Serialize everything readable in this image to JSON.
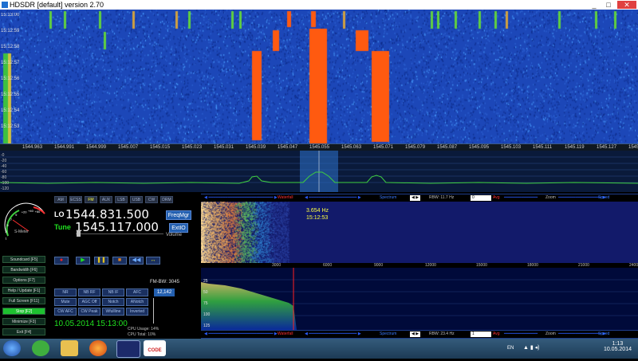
{
  "window": {
    "title": "HDSDR [default] version 2.70",
    "minimize": "_",
    "maximize": "□",
    "close": "✕"
  },
  "waterfall_top": {
    "time_labels": [
      "15:13:00",
      "15:12:59",
      "15:12:58",
      "15:12:57",
      "15:12:56",
      "15:12:55",
      "15:12:54",
      "15:12:53"
    ],
    "colors": {
      "background": "#1c47b8",
      "signal": "#ff5a10",
      "marker_green": "#60d040",
      "marker_yellow": "#d0c040"
    }
  },
  "freq_axis": {
    "labels": [
      "1544.963",
      "1544.991",
      "1544.999",
      "1545.007",
      "1545.015",
      "1545.023",
      "1545.031",
      "1545.039",
      "1545.047",
      "1545.055",
      "1545.063",
      "1545.071",
      "1545.079",
      "1545.087",
      "1545.095",
      "1545.103",
      "1545.111",
      "1545.119",
      "1545.127",
      "1545.135"
    ]
  },
  "spectrum": {
    "db_labels": [
      "-0",
      "-20",
      "-40",
      "-60",
      "-80",
      "-100",
      "-120"
    ]
  },
  "mode_buttons": [
    {
      "label": "AM"
    },
    {
      "label": "ECSS"
    },
    {
      "label": "FM",
      "active": true
    },
    {
      "label": "AUX"
    },
    {
      "label": "LSB"
    },
    {
      "label": "USB"
    },
    {
      "label": "CW"
    },
    {
      "label": "DRM"
    }
  ],
  "lo": {
    "label": "LO",
    "value": "1544.831.500"
  },
  "tune": {
    "label": "Tune",
    "value": "1545.117.000"
  },
  "freqmgr_button": "FreqMgr",
  "extio_button": "ExtIO",
  "volume_label": "Volume",
  "smeter": {
    "scale_labels": [
      "1",
      "3",
      "5",
      "7",
      "9",
      "+20",
      "+40",
      "+60"
    ],
    "label": "S-Meter"
  },
  "left_buttons": [
    {
      "label": "Soundcard [F5]"
    },
    {
      "label": "Bandwidth [F6]"
    },
    {
      "label": "Options [F7]"
    },
    {
      "label": "Help / Update [F1]"
    },
    {
      "label": "Full Screen [F11]"
    },
    {
      "label": "Stop [F2]",
      "green": true
    },
    {
      "label": "Minimize [F3]"
    },
    {
      "label": "Exit [F4]"
    }
  ],
  "transport": {
    "record": "●",
    "play": "▶",
    "pause": "❚❚",
    "stop": "■",
    "rewind": "◀◀",
    "loop": "↔"
  },
  "dsp_buttons": [
    [
      "NR",
      "NB RF",
      "NB IF",
      "AFC"
    ],
    [
      "Mute",
      "AGC Off",
      "Notch",
      "ANotch"
    ],
    [
      "CW AFC",
      "CW Peak",
      "Wfullline",
      "Inverted"
    ]
  ],
  "fm_bw": {
    "label": "FM-BW: 3045",
    "value": "12,142"
  },
  "datetime": "10.05.2014 15:13:00",
  "cpu": {
    "line1": "CPU Usage: 14%",
    "line2": "CPU Total: 10%"
  },
  "lower_waterfall": {
    "freq_readout": "3.654 Hz",
    "time_readout": "15:12:53",
    "axis_labels": [
      "3000",
      "6000",
      "9000",
      "12000",
      "15000",
      "18000",
      "21000",
      "24000"
    ]
  },
  "lower_spectrum": {
    "db_labels": [
      "25",
      "50",
      "75",
      "100",
      "125"
    ]
  },
  "control_bar_top": {
    "waterfall": "Waterfall",
    "spectrum": "Spectrum",
    "rbw": "RBW: 11.7 Hz",
    "avg_value": "0",
    "avg": "Avg",
    "zoom": "Zoom",
    "speed": "Speed"
  },
  "control_bar_bottom": {
    "waterfall": "Waterfall",
    "spectrum": "Spectrum",
    "rbw": "RBW: 23.4 Hz",
    "avg_value": "1",
    "avg": "Avg",
    "zoom": "Zoom",
    "speed": "Speed"
  },
  "taskbar": {
    "lang": "EN",
    "time": "1:13",
    "date": "10.05.2014",
    "pinned": [
      "start-orb",
      "utorrent",
      "explorer",
      "firefox",
      "hdsdr",
      "w-code"
    ],
    "w_code_label": "CODE"
  }
}
